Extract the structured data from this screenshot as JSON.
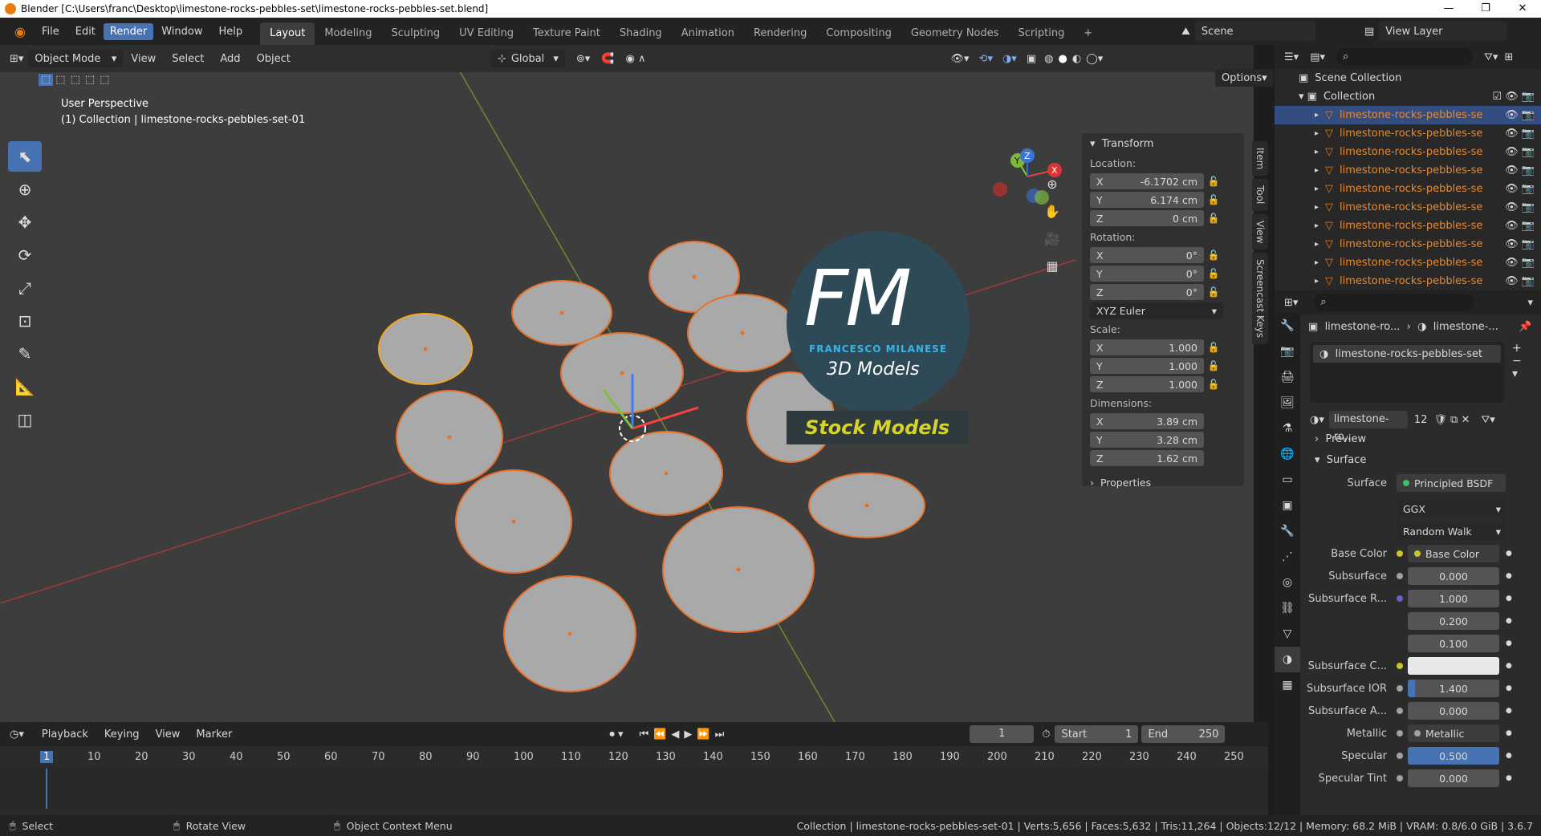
{
  "title": "Blender [C:\\Users\\franc\\Desktop\\limestone-rocks-pebbles-set\\limestone-rocks-pebbles-set.blend]",
  "menu": [
    "File",
    "Edit",
    "Render",
    "Window",
    "Help"
  ],
  "menu_active": "Render",
  "workspaces": [
    "Layout",
    "Modeling",
    "Sculpting",
    "UV Editing",
    "Texture Paint",
    "Shading",
    "Animation",
    "Rendering",
    "Compositing",
    "Geometry Nodes",
    "Scripting",
    "+"
  ],
  "workspace_active": "Layout",
  "scene": "Scene",
  "view_layer": "View Layer",
  "viewport": {
    "mode": "Object Mode",
    "menus": [
      "View",
      "Select",
      "Add",
      "Object"
    ],
    "transform_orientation": "Global",
    "options": "Options",
    "overlay_title": "User Perspective",
    "overlay_sub": "(1) Collection | limestone-rocks-pebbles-set-01"
  },
  "npanel": {
    "header": "Transform",
    "location_label": "Location:",
    "location": [
      {
        "k": "X",
        "v": "-6.1702 cm"
      },
      {
        "k": "Y",
        "v": "6.174 cm"
      },
      {
        "k": "Z",
        "v": "0 cm"
      }
    ],
    "rotation_label": "Rotation:",
    "rotation": [
      {
        "k": "X",
        "v": "0°"
      },
      {
        "k": "Y",
        "v": "0°"
      },
      {
        "k": "Z",
        "v": "0°"
      }
    ],
    "rotation_mode": "XYZ Euler",
    "scale_label": "Scale:",
    "scale": [
      {
        "k": "X",
        "v": "1.000"
      },
      {
        "k": "Y",
        "v": "1.000"
      },
      {
        "k": "Z",
        "v": "1.000"
      }
    ],
    "dimensions_label": "Dimensions:",
    "dimensions": [
      {
        "k": "X",
        "v": "3.89 cm"
      },
      {
        "k": "Y",
        "v": "3.28 cm"
      },
      {
        "k": "Z",
        "v": "1.62 cm"
      }
    ],
    "properties": "Properties"
  },
  "side_tabs": [
    "Item",
    "Tool",
    "View",
    "Screencast Keys"
  ],
  "watermark": {
    "letters": "FM",
    "name": "FRANCESCO MILANESE",
    "sub": "3D Models",
    "stock": "Stock Models"
  },
  "outliner": {
    "root": "Scene Collection",
    "collection": "Collection",
    "item": "limestone-rocks-pebbles-se",
    "count": 10
  },
  "props": {
    "breadcrumb1": "limestone-ro...",
    "breadcrumb2": "limestone-...",
    "material_slot": "limestone-rocks-pebbles-set",
    "material_name": "limestone-ro...",
    "users": "12",
    "preview": "Preview",
    "surface_panel": "Surface",
    "surface_label": "Surface",
    "surface_value": "Principled BSDF",
    "dist": "GGX",
    "sss_method": "Random Walk",
    "rows": [
      {
        "l": "Base Color",
        "v": "Base Color",
        "type": "link",
        "dot": "#c7c729"
      },
      {
        "l": "Subsurface",
        "v": "0.000",
        "type": "num",
        "dot": "#a1a1a1"
      },
      {
        "l": "Subsurface R...",
        "v": "1.000",
        "type": "num",
        "dot": "#6363c7"
      },
      {
        "l": "",
        "v": "0.200",
        "type": "num"
      },
      {
        "l": "",
        "v": "0.100",
        "type": "num"
      },
      {
        "l": "Subsurface C...",
        "v": "",
        "type": "color",
        "dot": "#c7c729"
      },
      {
        "l": "Subsurface IOR",
        "v": "1.400",
        "type": "numfill",
        "dot": "#a1a1a1"
      },
      {
        "l": "Subsurface A...",
        "v": "0.000",
        "type": "num",
        "dot": "#a1a1a1"
      },
      {
        "l": "Metallic",
        "v": "Metallic",
        "type": "link",
        "dot": "#a1a1a1"
      },
      {
        "l": "Specular",
        "v": "0.500",
        "type": "blue",
        "dot": "#a1a1a1"
      },
      {
        "l": "Specular Tint",
        "v": "0.000",
        "type": "num",
        "dot": "#a1a1a1"
      }
    ]
  },
  "timeline": {
    "menus": [
      "Playback",
      "Keying",
      "View",
      "Marker"
    ],
    "current": "1",
    "start_label": "Start",
    "start": "1",
    "end_label": "End",
    "end": "250",
    "ticks": [
      "1",
      "10",
      "20",
      "30",
      "40",
      "50",
      "60",
      "70",
      "80",
      "90",
      "100",
      "110",
      "120",
      "130",
      "140",
      "150",
      "160",
      "170",
      "180",
      "190",
      "200",
      "210",
      "220",
      "230",
      "240",
      "250"
    ]
  },
  "status": {
    "select": "Select",
    "rotate": "Rotate View",
    "context": "Object Context Menu",
    "stats": "Collection | limestone-rocks-pebbles-set-01 | Verts:5,656 | Faces:5,632 | Tris:11,264 | Objects:12/12 | Memory: 68.2 MiB | VRAM: 0.8/6.0 GiB | 3.6.7"
  }
}
